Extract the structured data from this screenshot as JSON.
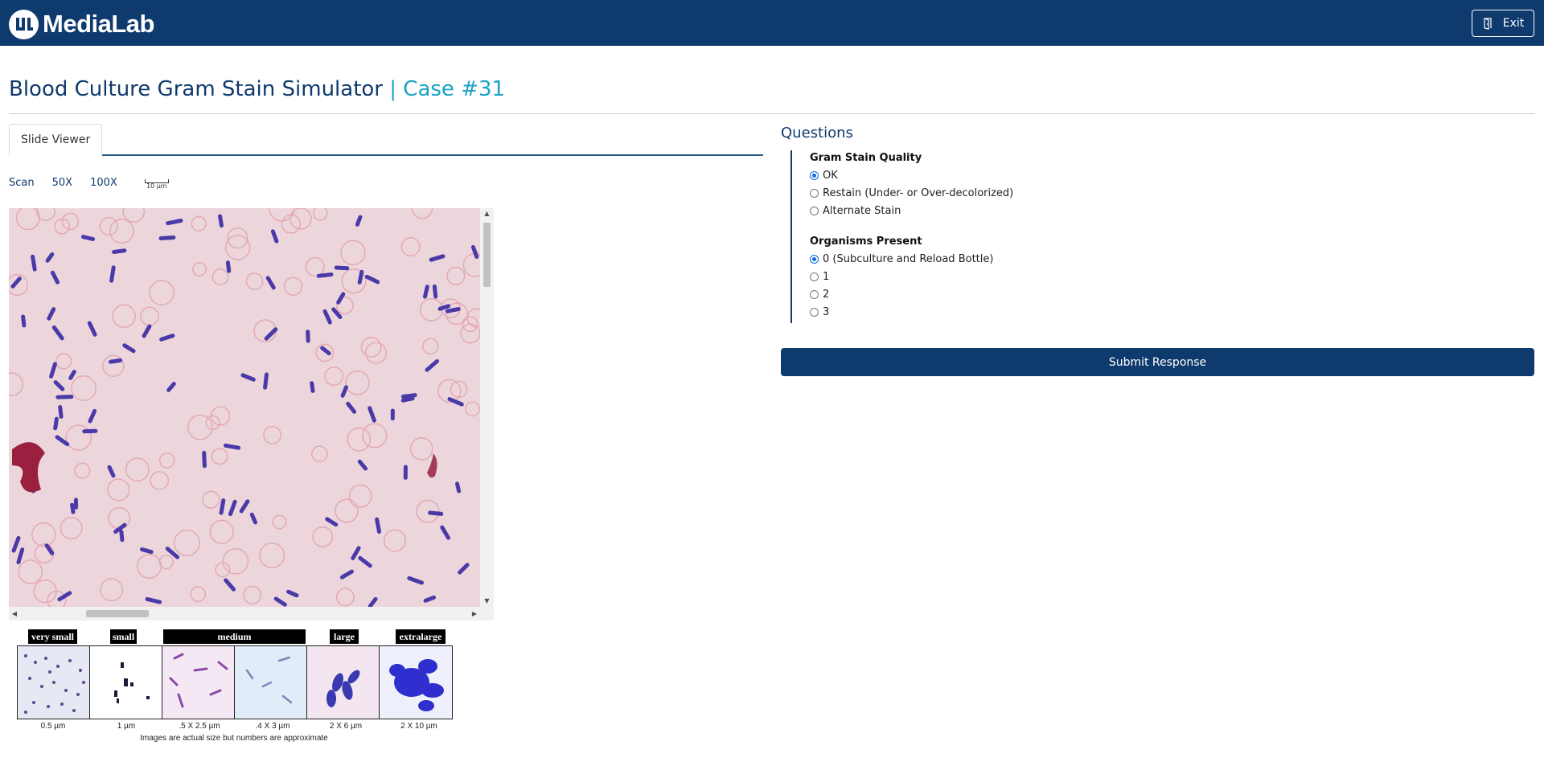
{
  "header": {
    "logo_text": "MediaLab",
    "exit_label": "Exit",
    "bg_color": "#0e3a6e"
  },
  "title": {
    "main": "Blood Culture Gram Stain Simulator",
    "separator": "|",
    "case": "Case #31"
  },
  "tabs": [
    {
      "label": "Slide Viewer",
      "active": true
    }
  ],
  "zoom": {
    "options": [
      "Scan",
      "50X",
      "100X"
    ],
    "scale_label": "10 µm"
  },
  "size_legend": {
    "headers": [
      "very small",
      "small",
      "medium",
      "large",
      "extralarge"
    ],
    "captions": [
      "0.5 µm",
      "1 µm",
      ".5 X 2.5 µm",
      ".4 X 3 µm",
      "2 X 6 µm",
      "2 X 10 µm"
    ],
    "note": "Images are actual size but numbers are approximate"
  },
  "questions": {
    "heading": "Questions",
    "groups": [
      {
        "title": "Gram Stain Quality",
        "options": [
          {
            "label": "OK",
            "checked": true
          },
          {
            "label": "Restain (Under- or Over-decolorized)",
            "checked": false
          },
          {
            "label": "Alternate Stain",
            "checked": false
          }
        ]
      },
      {
        "title": "Organisms Present",
        "options": [
          {
            "label": "0 (Subculture and Reload Bottle)",
            "checked": true
          },
          {
            "label": "1",
            "checked": false
          },
          {
            "label": "2",
            "checked": false
          },
          {
            "label": "3",
            "checked": false
          }
        ]
      }
    ],
    "submit_label": "Submit Response"
  }
}
